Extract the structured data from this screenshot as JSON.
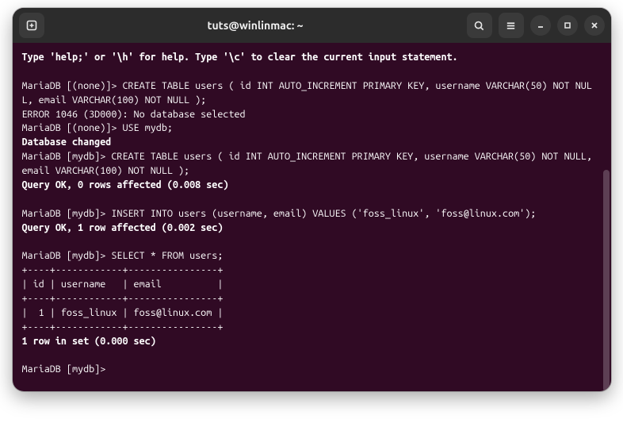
{
  "titlebar": {
    "title": "tuts@winlinmac: ~"
  },
  "lines": [
    {
      "text": "Type 'help;' or '\\h' for help. Type '\\c' to clear the current input statement.",
      "bold": true
    },
    {
      "text": " "
    },
    {
      "text": "MariaDB [(none)]> CREATE TABLE users ( id INT AUTO_INCREMENT PRIMARY KEY, username VARCHAR(50) NOT NULL, email VARCHAR(100) NOT NULL );"
    },
    {
      "text": "ERROR 1046 (3D000): No database selected"
    },
    {
      "text": "MariaDB [(none)]> USE mydb;"
    },
    {
      "text": "Database changed",
      "bold": true
    },
    {
      "text": "MariaDB [mydb]> CREATE TABLE users ( id INT AUTO_INCREMENT PRIMARY KEY, username VARCHAR(50) NOT NULL, email VARCHAR(100) NOT NULL );"
    },
    {
      "text": "Query OK, 0 rows affected (0.008 sec)",
      "bold": true
    },
    {
      "text": " "
    },
    {
      "text": "MariaDB [mydb]> INSERT INTO users (username, email) VALUES ('foss_linux', 'foss@linux.com');"
    },
    {
      "text": "Query OK, 1 row affected (0.002 sec)",
      "bold": true
    },
    {
      "text": " "
    },
    {
      "text": "MariaDB [mydb]> SELECT * FROM users;"
    },
    {
      "text": "+----+------------+----------------+"
    },
    {
      "text": "| id | username   | email          |"
    },
    {
      "text": "+----+------------+----------------+"
    },
    {
      "text": "|  1 | foss_linux | foss@linux.com |"
    },
    {
      "text": "+----+------------+----------------+"
    },
    {
      "text": "1 row in set (0.000 sec)",
      "bold": true
    },
    {
      "text": " "
    },
    {
      "text": "MariaDB [mydb]> "
    }
  ]
}
